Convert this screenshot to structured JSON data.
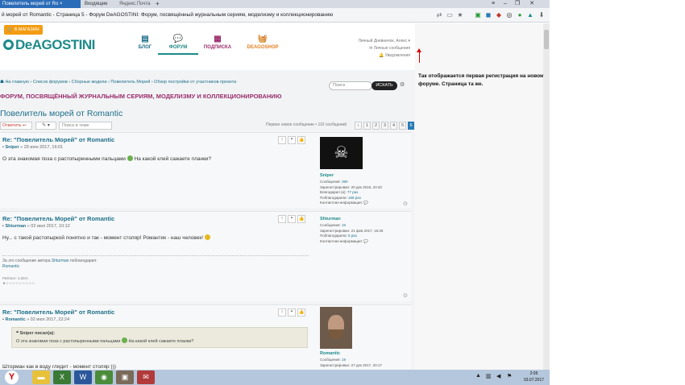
{
  "browser": {
    "tabs": [
      {
        "label": "Повелитель морей от Ro ×"
      },
      {
        "label": "Входящие"
      },
      {
        "label": "Яндекс.Почта"
      }
    ],
    "new_tab": "+",
    "url": "й морей от Romantic - Страница 5 - Форум DeAGOSTINI: Форум, посвящённый журнальным сериям, моделизму и коллекционированию"
  },
  "header": {
    "shop_button": "В МАГАЗИН",
    "logo_text": "DeAGOSTINI",
    "nav": [
      {
        "label": "БЛОГ",
        "color": "#1e6f8a"
      },
      {
        "label": "ФОРУМ",
        "color": "#1e8a8a"
      },
      {
        "label": "ПОДПИСКА",
        "color": "#9b2c6b"
      },
      {
        "label": "DEAGOSHOP",
        "color": "#e67e22"
      }
    ],
    "user_menu": {
      "user": "Личный Дневничок, Алекс ▾",
      "messages": "Личные сообщения",
      "notifications": "Уведомления"
    }
  },
  "breadcrumb": "☗ На главную › Список форумов › Сборные модели › Повелитель Морей › Обзор постройки от участников проекта",
  "search": {
    "placeholder": "Поиск",
    "button": "ИСКАТЬ"
  },
  "forum_title": "ФОРУМ, ПОСВЯЩЁННЫЙ ЖУРНАЛЬНЫМ СЕРИЯМ, МОДЕЛИЗМУ И КОЛЛЕКЦИОНИРОВАНИЮ",
  "topic_title": "Повелитель морей от Romantic",
  "toolbar": {
    "reply": "Ответить",
    "tools": "✎ ▾",
    "topic_search": "Поиск в теме",
    "pagination_info": "Первое новое сообщение • 110 сообщений",
    "pages": [
      "‹",
      "1",
      "2",
      "3",
      "4",
      "5",
      "6"
    ],
    "current_page": "6"
  },
  "posts": [
    {
      "title": "Re: \"Повелитель Морей\" от Romantic",
      "author": "Sniper",
      "date": "» 29 июн 2017, 16:01",
      "body_start": "О эта знакомая поза с растопыренными пальцами",
      "body_end": "На какой клей сажаете планки?",
      "username": "Sniper",
      "stats": [
        {
          "label": "Сообщения:",
          "value": "390"
        },
        {
          "label": "Зарегистрирован:",
          "value": "20 дек 2016, 23:40"
        },
        {
          "label": "Благодарил (а):",
          "value": "77 раз"
        },
        {
          "label": "Поблагодарили:",
          "value": "168 раз"
        },
        {
          "label": "Контактная информация:",
          "value": "💬"
        }
      ]
    },
    {
      "title": "Re: \"Повелитель Морей\" от Romantic",
      "author": "Shturman",
      "date": "» 02 июл 2017, 10:12",
      "body": "Ну... с такой растопыркой понятно и так - момент столяр! Романтик - наш человек!",
      "username": "Shturman",
      "stats": [
        {
          "label": "Сообщения:",
          "value": "16"
        },
        {
          "label": "Зарегистрирован:",
          "value": "21 фев 2017, 15:25"
        },
        {
          "label": "Поблагодарили:",
          "value": "5 раз"
        },
        {
          "label": "Контактная информация:",
          "value": "💬"
        }
      ],
      "thanks_line": "За это сообщение автора",
      "thanks_author": "Shturman",
      "thanks_end": "поблагодарил:",
      "thanks_user": "Romantic",
      "rating_label": "Рейтинг: 4.55%",
      "rating_stars": "★☆☆☆☆☆☆☆☆☆"
    },
    {
      "title": "Re: \"Повелитель Морей\" от Romantic",
      "author": "Romantic",
      "date": "» 02 июл 2017, 22:24",
      "quote_header": "❝ Sniper писал(а):",
      "quote_start": "О эта знакомая поза с растопыренными пальцами",
      "quote_end": "На какой клей сажаете планки?",
      "body": "Шторман как в воду глядит - момент столяр )))",
      "username": "Romantic",
      "stats": [
        {
          "label": "Сообщения:",
          "value": "19"
        },
        {
          "label": "Зарегистрирован:",
          "value": "27 дек 2017, 20:17"
        }
      ]
    }
  ],
  "annotation": "Так отображается первая регистрация на новом форуме. Страница та же.",
  "taskbar": {
    "start": "Y",
    "clock_time": "2:05",
    "clock_date": "03.07.2017"
  }
}
